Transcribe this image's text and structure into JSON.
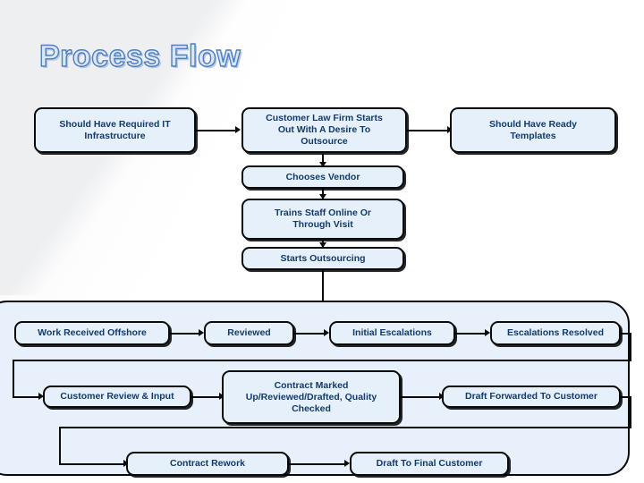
{
  "title": "Process Flow",
  "theme": {
    "page_bg": "#ffffff",
    "panel_bg": "#e8f1fb",
    "box_bg": "#e6f0fb",
    "box_border": "#0b0b0b",
    "box_text": "#123a6b",
    "title_fill": "#dbe6f6",
    "title_outline": "#4f7fc0"
  },
  "top_section": {
    "nodes": [
      {
        "id": "it-infrastructure",
        "label": "Should Have Required IT\nInfrastructure"
      },
      {
        "id": "customer-law-firm-desire",
        "label": "Customer  Law Firm Starts\nOut With A Desire To\nOutsource"
      },
      {
        "id": "ready-templates",
        "label": "Should Have Ready\nTemplates"
      },
      {
        "id": "chooses-vendor",
        "label": "Chooses Vendor"
      },
      {
        "id": "trains-staff",
        "label": "Trains Staff Online Or\nThrough Visit"
      },
      {
        "id": "starts-outsourcing",
        "label": "Starts Outsourcing"
      }
    ]
  },
  "lower_section": {
    "nodes": [
      {
        "id": "work-received-offshore",
        "label": "Work Received Offshore"
      },
      {
        "id": "reviewed",
        "label": "Reviewed"
      },
      {
        "id": "initial-escalations",
        "label": "Initial Escalations"
      },
      {
        "id": "escalations-resolved",
        "label": "Escalations Resolved"
      },
      {
        "id": "customer-review-input",
        "label": "Customer Review & Input"
      },
      {
        "id": "contract-marked-up",
        "label": "Contract Marked\nUp/Reviewed/Drafted, Quality\nChecked"
      },
      {
        "id": "draft-forwarded-to-customer",
        "label": "Draft Forwarded To Customer"
      },
      {
        "id": "contract-rework",
        "label": "Contract Rework"
      },
      {
        "id": "draft-to-final-customer",
        "label": "Draft To Final Customer"
      }
    ]
  }
}
